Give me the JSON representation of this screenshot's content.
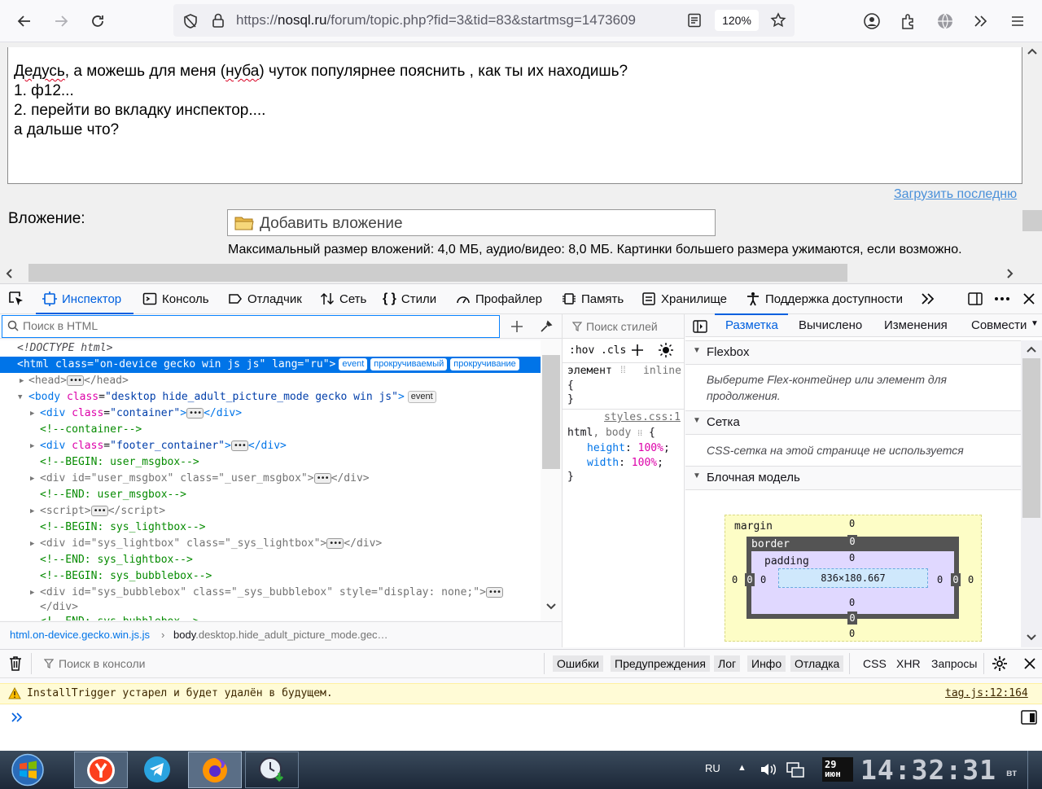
{
  "browser": {
    "url_prefix": "https://",
    "url_host": "nosql.ru",
    "url_path": "/forum/topic.php?fid=3&tid=83&startmsg=1473609",
    "zoom": "120%"
  },
  "page": {
    "reply_word1": "Дедусь",
    "reply_line1_mid": ", а можешь для меня (",
    "reply_word2": "нуба",
    "reply_line1_end": ") чуток популярнее пояснить , как ты их находишь?",
    "reply_line2": "1. ф12...",
    "reply_line3": "2. перейти во вкладку инспектор....",
    "reply_line4": "а дальше что?",
    "upload_last": "Загрузить последню",
    "attachment_label": "Вложение:",
    "add_attachment": "Добавить вложение",
    "attachment_note": "Максимальный размер вложений: 4,0 МБ, аудио/видео: 8,0 МБ. Картинки большего размера ужимаются, если возможно."
  },
  "devtools": {
    "tabs": [
      "Инспектор",
      "Консоль",
      "Отладчик",
      "Сеть",
      "Стили",
      "Профайлер",
      "Память",
      "Хранилище",
      "Поддержка доступности"
    ],
    "search_html_placeholder": "Поиск в HTML",
    "markup": {
      "doctype": "<!DOCTYPE html>",
      "html_class": "on-device gecko win js js",
      "html_lang": "ru",
      "badges": [
        "event",
        "прокручиваемый",
        "прокручивание"
      ],
      "body_class": "desktop hide_adult_picture_mode gecko win js",
      "container_class": "container",
      "comment_container": "<!--container-->",
      "footer_class": "footer_container",
      "comment_begin_msgbox": "<!--BEGIN: user_msgbox-->",
      "msgbox_id": "user_msgbox",
      "msgbox_class": "_user_msgbox",
      "comment_end_msgbox": "<!--END: user_msgbox-->",
      "comment_begin_lightbox": "<!--BEGIN: sys_lightbox-->",
      "lightbox_id": "sys_lightbox",
      "lightbox_class": "_sys_lightbox",
      "comment_end_lightbox": "<!--END: sys_lightbox-->",
      "comment_begin_bubblebox": "<!--BEGIN: sys_bubblebox-->",
      "bubblebox_id": "sys_bubblebox",
      "bubblebox_class": "_sys_bubblebox",
      "bubblebox_style": "display: none;",
      "comment_end_bubblebox": "<!--END: sys_bubblebox-->"
    },
    "breadcrumb_1": "html.on-device.gecko.win.js.js",
    "breadcrumb_2_tag": "body",
    "breadcrumb_2_rest": ".desktop.hide_adult_picture_mode.gec…",
    "rules": {
      "search_placeholder": "Поиск стилей",
      "hov": ":hov",
      "cls": ".cls",
      "element_label": "элемент",
      "inline": "inline",
      "open_brace": "{",
      "close_brace": "}",
      "source": "styles.css:1",
      "selector_html": "html",
      "selector_body": "body",
      "prop1": "height",
      "val1": "100%",
      "prop2": "width",
      "val2": "100%"
    },
    "layout": {
      "tabs": [
        "Разметка",
        "Вычислено",
        "Изменения",
        "Совмести"
      ],
      "flexbox": "Flexbox",
      "flexbox_msg_1": "Выберите Flex-контейнер или элемент для",
      "flexbox_msg_2": "продолжения.",
      "grid": "Сетка",
      "grid_msg": "CSS-сетка на этой странице не используется",
      "box_model": "Блочная модель",
      "margin_label": "margin",
      "border_label": "border",
      "padding_label": "padding",
      "zero": "0",
      "content_size": "836×180.667"
    },
    "console": {
      "filter_placeholder": "Поиск в консоли",
      "filters": [
        "Ошибки",
        "Предупреждения",
        "Лог",
        "Инфо",
        "Отладка"
      ],
      "extra": [
        "CSS",
        "XHR",
        "Запросы"
      ],
      "warning": "InstallTrigger устарел и будет удалён в будущем.",
      "warning_source": "tag.js:12:164"
    }
  },
  "taskbar": {
    "lang": "RU",
    "day": "29",
    "month": "июн",
    "time": "14:32:31",
    "weekday": "вт"
  },
  "colors": {
    "accent": "#0060df",
    "selected_row": "#0074e8",
    "warning_bg": "#fffbd6"
  }
}
